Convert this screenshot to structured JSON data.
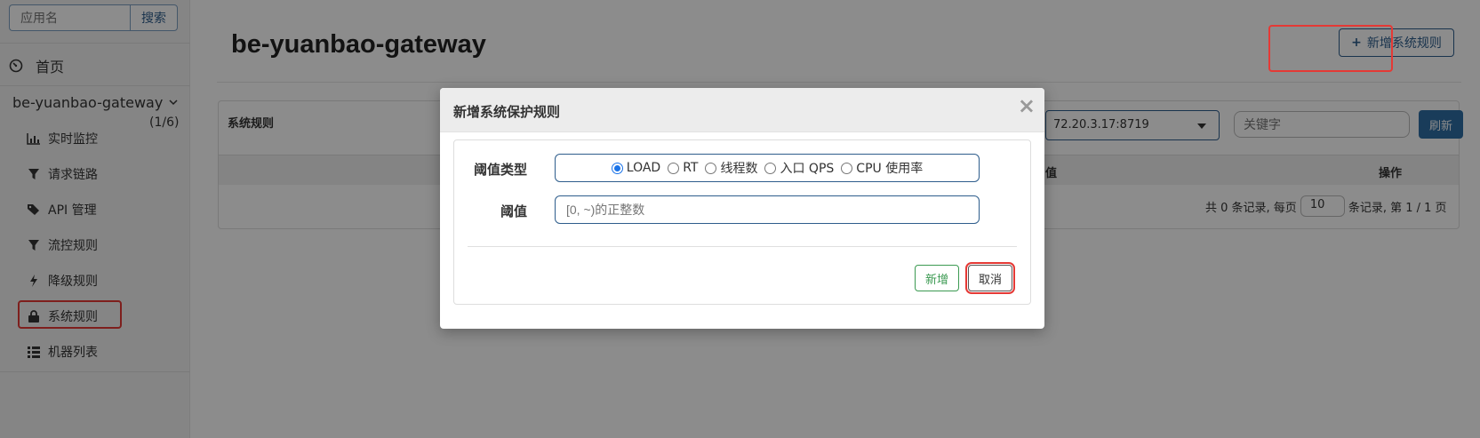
{
  "sidebar": {
    "search": {
      "placeholder": "应用名",
      "button_label": "搜索"
    },
    "home_label": "首页",
    "app": {
      "name": "be-yuanbao-gateway",
      "count": "(1/6)"
    },
    "menu": [
      {
        "label": "实时监控",
        "icon": "bar-chart-icon"
      },
      {
        "label": "请求链路",
        "icon": "filter-icon"
      },
      {
        "label": "API 管理",
        "icon": "tags-icon"
      },
      {
        "label": "流控规则",
        "icon": "filter-icon"
      },
      {
        "label": "降级规则",
        "icon": "flash-icon"
      },
      {
        "label": "系统规则",
        "icon": "lock-icon",
        "active": true
      },
      {
        "label": "机器列表",
        "icon": "list-icon"
      }
    ]
  },
  "main": {
    "title": "be-yuanbao-gateway",
    "add_button_label": "新增系统规则",
    "panel": {
      "title": "系统规则",
      "machine_value": "72.20.3.17:8719",
      "keyword_placeholder": "关键字",
      "refresh_label": "刷新",
      "columns": {
        "value": "值",
        "ops": "操作"
      },
      "pager": {
        "prefix": "共 0 条记录, 每页",
        "page_size": "10",
        "suffix": "条记录, 第 1 / 1 页"
      }
    }
  },
  "modal": {
    "title": "新增系统保护规则",
    "close": "×",
    "type_label": "阈值类型",
    "options": [
      "LOAD",
      "RT",
      "线程数",
      "入口 QPS",
      "CPU 使用率"
    ],
    "selected": "LOAD",
    "value_label": "阈值",
    "value_placeholder": "[0, ~)的正整数",
    "add_label": "新增",
    "cancel_label": "取消"
  },
  "colors": {
    "accent": "#2e5d8c",
    "primary_button": "#2e6da4",
    "success": "#3c9a52",
    "highlight": "#e53935"
  }
}
